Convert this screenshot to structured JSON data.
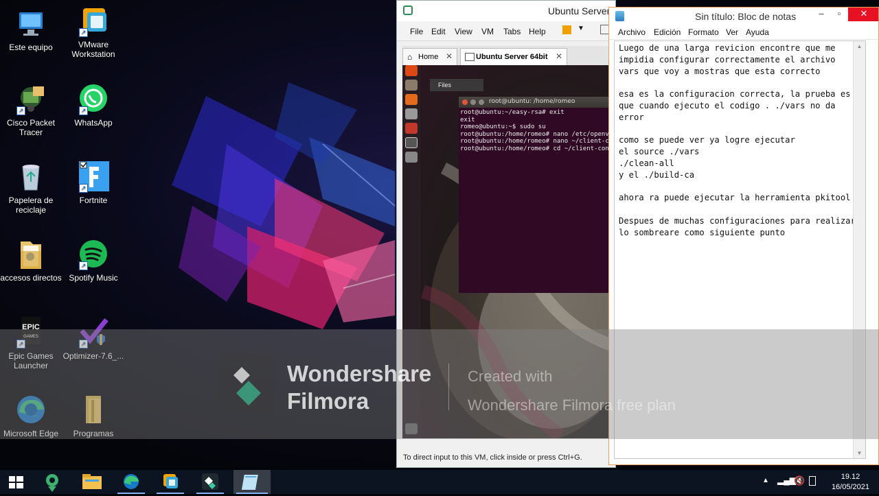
{
  "desktop": {
    "icons": [
      {
        "label": "Este equipo"
      },
      {
        "label": "VMware Workstation"
      },
      {
        "label": "Cisco Packet Tracer"
      },
      {
        "label": "WhatsApp"
      },
      {
        "label": "Papelera de reciclaje"
      },
      {
        "label": "Fortnite"
      },
      {
        "label": "accesos directos"
      },
      {
        "label": "Spotify Music"
      },
      {
        "label": "Epic Games Launcher"
      },
      {
        "label": "Optimizer-7.6_..."
      },
      {
        "label": "Microsoft Edge"
      },
      {
        "label": "Programas"
      }
    ]
  },
  "vmware": {
    "title": "Ubuntu Server",
    "menu": [
      "File",
      "Edit",
      "View",
      "VM",
      "Tabs",
      "Help"
    ],
    "tabs": [
      {
        "label": "Home"
      },
      {
        "label": "Ubuntu Server 64bit"
      }
    ],
    "guest": {
      "files_label": "Files",
      "terminal_title": "root@ubuntu: /home/romeo",
      "terminal_lines": "root@ubuntu:~/easy-rsa# exit\nexit\nromeo@ubuntu:~$ sudo su\nroot@ubuntu:/home/romeo# nano /etc/openvpn/server.conf\nroot@ubuntu:/home/romeo# nano ~/client-configs/base.conf\nroot@ubuntu:/home/romeo# cd ~/client-configs"
    },
    "status": "To direct input to this VM, click inside or press Ctrl+G."
  },
  "notepad": {
    "title": "Sin título: Bloc de notas",
    "menu": [
      "Archivo",
      "Edición",
      "Formato",
      "Ver",
      "Ayuda"
    ],
    "content": "Luego de una larga revicion encontre que me\nimpidia configurar correctamente el archivo\nvars que voy a mostras que esta correcto\n\nesa es la configuracion correcta, la prueba es\nque cuando ejecuto el codigo . ./vars no da\nerror\n\ncomo se puede ver ya logre ejecutar\nel source ./vars\n./clean-all\ny el ./build-ca\n\nahora ra puede ejecutar la herramienta pkitool\n\nDespues de muchas configuraciones para realizar\nlo sombreare como siguiente punto"
  },
  "watermark": {
    "brand_line1": "Wondershare",
    "brand_line2": "Filmora",
    "created_line1": "Created with",
    "created_line2": "Wondershare Filmora free plan"
  },
  "taskbar": {
    "time": "19.12",
    "date": "16/05/2021",
    "icons": [
      "windows-start-icon",
      "pin-app-icon",
      "file-explorer-icon",
      "edge-icon",
      "vmware-icon",
      "filmora-icon",
      "notepad-icon"
    ]
  },
  "colors": {
    "terminal_bg": "#300a24",
    "taskbar_bg": "#0b1420",
    "close_red": "#e81123",
    "notepad_border": "#f0a060"
  }
}
